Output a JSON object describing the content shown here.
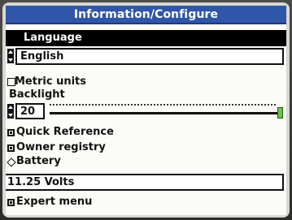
{
  "window": {
    "title": "Information/Configure"
  },
  "language": {
    "header": "Language",
    "value": "English"
  },
  "metric": {
    "label": "Metric units",
    "checked": false
  },
  "backlight": {
    "label": "Backlight",
    "value": "20",
    "level_percent": 100
  },
  "menu": {
    "quick_reference": "Quick Reference",
    "owner_registry": "Owner registry",
    "battery": "Battery",
    "expert_menu": "Expert menu"
  },
  "battery": {
    "value": "11.25 Volts"
  },
  "colors": {
    "title_bar": "#2f56a8",
    "thumb": "#6cc44a",
    "highlight": "#000000"
  }
}
